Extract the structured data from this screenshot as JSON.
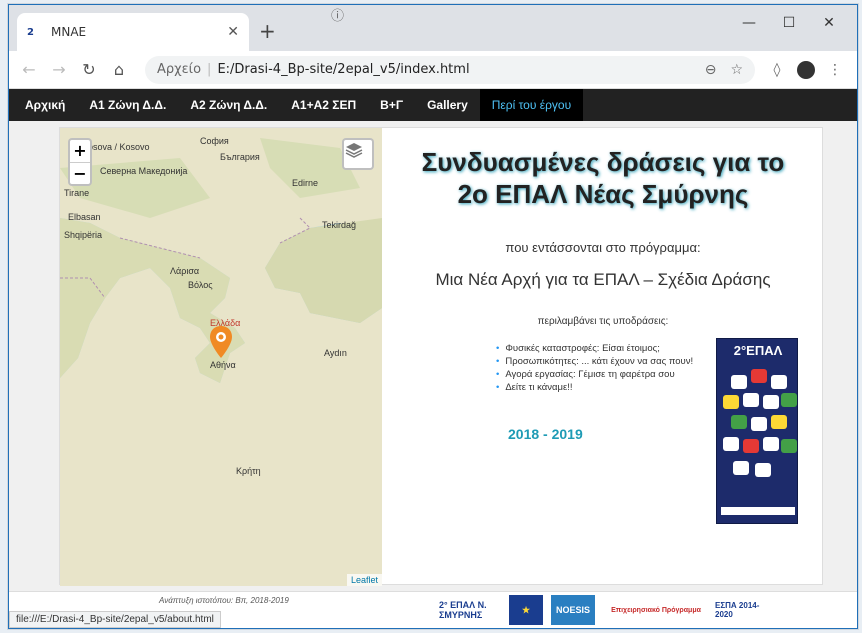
{
  "browser": {
    "tab_title": "MNAE",
    "favicon_text": "2",
    "url_label": "Αρχείο",
    "url": "E:/Drasi-4_Bp-site/2epal_v5/index.html",
    "status_url": "file:///E:/Drasi-4_Bp-site/2epal_v5/about.html"
  },
  "nav": {
    "items": [
      {
        "label": "Αρχική"
      },
      {
        "label": "Α1 Ζώνη Δ.Δ."
      },
      {
        "label": "Α2 Ζώνη Δ.Δ."
      },
      {
        "label": "Α1+Α2 ΣΕΠ"
      },
      {
        "label": "Β+Γ"
      },
      {
        "label": "Gallery"
      },
      {
        "label": "Περί του έργου"
      }
    ],
    "active_index": 6
  },
  "map": {
    "zoom_in": "+",
    "zoom_out": "−",
    "attribution": "Leaflet",
    "labels": {
      "kosovo": "Kosova / Kosovo",
      "sofia": "София",
      "bulgaria": "България",
      "macedonia": "Северна Македонија",
      "tirane": "Tirane",
      "elbasan": "Elbasan",
      "shqiperia": "Shqipëria",
      "edirne": "Edirne",
      "tekirdag": "Tekirdağ",
      "larisa": "Λάρισα",
      "volos": "Βόλος",
      "ellada": "Ελλάδα",
      "athina": "Αθήνα",
      "aydin": "Aydın",
      "kriti": "Κρήτη"
    }
  },
  "info": {
    "headline_line1": "Συνδυασμένες δράσεις για το",
    "headline_line2": "2ο ΕΠΑΛ Νέας Σμύρνης",
    "subtitle": "που εντάσσονται στο πρόγραμμα:",
    "program": "Μια Νέα Αρχή για τα ΕΠΑΛ – Σχέδια Δράσης",
    "subactions_title": "περιλαμβάνει τις υποδράσεις:",
    "subactions": [
      "Φυσικές καταστροφές: Είσαι έτοιμος;",
      "Προσωπικότητες: ... κάτι έχουν να σας πουν!",
      "Αγορά εργασίας: Γέμισε τη φαρέτρα σου",
      "Δείτε τι κάναμε!!"
    ],
    "years": "2018 - 2019",
    "poster_title": "2°ΕΠΑΛ"
  },
  "footer": {
    "credit": "Ανάπτυξη ιστοτόπου: Βπ, 2018-2019",
    "logo_epal": "2° ΕΠΑΛ Ν. ΣΜΥΡΝΗΣ",
    "logo_noesis": "NOESIS",
    "logo_program": "Επιχειρησιακό Πρόγραμμα",
    "logo_espa": "ΕΣΠΑ 2014-2020"
  },
  "colors": {
    "nav_bg": "#222222",
    "nav_active": "#4fc3f7",
    "accent": "#1e9bb5"
  }
}
